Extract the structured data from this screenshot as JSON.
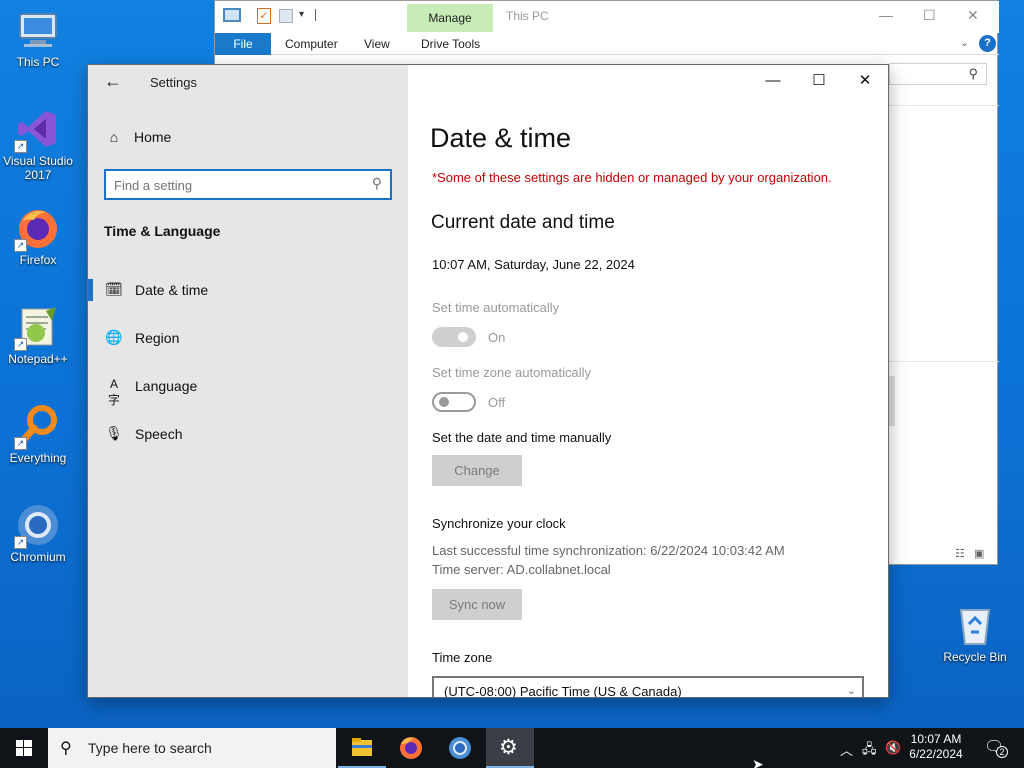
{
  "desktop_icons": [
    {
      "label": "This PC",
      "icon": "this-pc-icon"
    },
    {
      "label": "Visual Studio 2017",
      "icon": "visual-studio-icon"
    },
    {
      "label": "Firefox",
      "icon": "firefox-icon"
    },
    {
      "label": "Notepad++",
      "icon": "notepad-plus-plus-icon"
    },
    {
      "label": "Everything",
      "icon": "everything-search-icon"
    },
    {
      "label": "Chromium",
      "icon": "chromium-icon"
    }
  ],
  "recycle_bin": {
    "label": "Recycle Bin"
  },
  "explorer": {
    "title": "This PC",
    "manage_tab": "Manage",
    "tabs": {
      "file": "File",
      "computer": "Computer",
      "view": "View",
      "drive_tools": "Drive Tools"
    },
    "help": "?"
  },
  "settings": {
    "app_title": "Settings",
    "home_label": "Home",
    "search_placeholder": "Find a setting",
    "section_title": "Time & Language",
    "nav_items": [
      {
        "label": "Date & time",
        "icon": "clock-calendar-icon",
        "active": true
      },
      {
        "label": "Region",
        "icon": "globe-icon",
        "active": false
      },
      {
        "label": "Language",
        "icon": "language-icon",
        "active": false
      },
      {
        "label": "Speech",
        "icon": "microphone-icon",
        "active": false
      }
    ],
    "page_title": "Date & time",
    "org_notice": "*Some of these settings are hidden or managed by your organization.",
    "current_heading": "Current date and time",
    "current_datetime": "10:07 AM, Saturday, June 22, 2024",
    "set_time_auto": {
      "label": "Set time automatically",
      "state": "On",
      "enabled": false
    },
    "set_tz_auto": {
      "label": "Set time zone automatically",
      "state": "Off",
      "enabled": true
    },
    "manual": {
      "label": "Set the date and time manually",
      "button": "Change"
    },
    "sync": {
      "label": "Synchronize your clock",
      "last_sync": "Last successful time synchronization: 6/22/2024 10:03:42 AM",
      "server": "Time server: AD.collabnet.local",
      "button": "Sync now"
    },
    "timezone": {
      "label": "Time zone",
      "value": "(UTC-08:00) Pacific Time (US & Canada)"
    }
  },
  "taskbar": {
    "search_placeholder": "Type here to search",
    "apps": [
      {
        "name": "file-explorer-icon",
        "open": true
      },
      {
        "name": "firefox-icon",
        "open": false
      },
      {
        "name": "chromium-icon",
        "open": false
      },
      {
        "name": "settings-gear-icon",
        "open": true,
        "active": true
      }
    ],
    "clock_time": "10:07 AM",
    "clock_date": "6/22/2024",
    "notification_count": "2"
  }
}
